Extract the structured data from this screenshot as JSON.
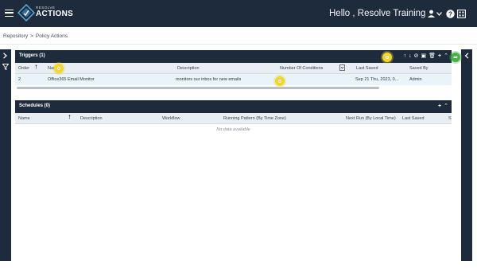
{
  "app": {
    "brand_top": "RESOLVE",
    "brand_main": "ACTIONS",
    "greeting": "Hello , Resolve Training",
    "icons": [
      "menu-icon",
      "user-icon",
      "chevron-down-icon",
      "help-icon",
      "window-icon"
    ]
  },
  "breadcrumb": {
    "root": "Repository",
    "separator": ">",
    "current": "Policy Actions"
  },
  "triggers": {
    "title": "Triggers (1)",
    "tools": [
      "arrow-up-icon",
      "arrow-down-icon",
      "block-icon",
      "copy-icon",
      "delete-icon",
      "add-icon",
      "collapse-icon"
    ],
    "columns": [
      "Order",
      "Name",
      "Description",
      "Number Of Conditions",
      "Last Saved",
      "Saved By"
    ],
    "rows": [
      {
        "order": "2",
        "name": "Office365 Email Monitor",
        "description": "monitors our inbox for new emails",
        "conditions": "",
        "last_saved": "Sep 21 Thu, 2023, 0...",
        "saved_by": "Admin"
      }
    ]
  },
  "schedules": {
    "title": "Schedules (0)",
    "columns": [
      "Name",
      "Description",
      "Workflow",
      "Running Pattern (By Time Zone)",
      "Next Run (By Local Time)",
      "Last Saved",
      "S"
    ],
    "empty_text": "No data available"
  },
  "colors": {
    "header": "#1d2b3d",
    "row_selected": "#e8f4f8",
    "hint_yellow": "#f3d431",
    "hint_green": "#4cae4c"
  }
}
